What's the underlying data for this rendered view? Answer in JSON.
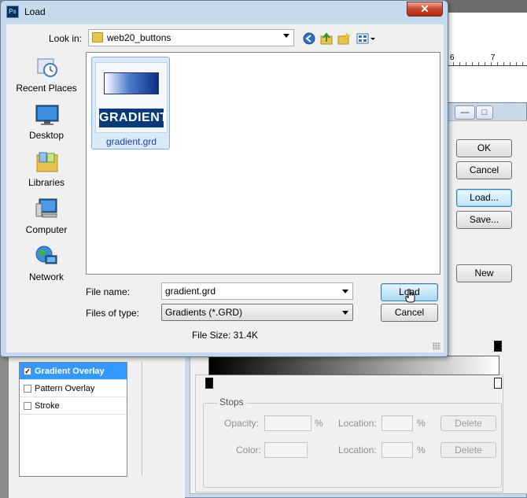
{
  "load_dialog": {
    "title": "Load",
    "close_label": "✕",
    "look_in_label": "Look in:",
    "look_in_value": "web20_buttons",
    "places": [
      {
        "label": "Recent Places",
        "icon": "recent-places-icon"
      },
      {
        "label": "Desktop",
        "icon": "desktop-icon"
      },
      {
        "label": "Libraries",
        "icon": "libraries-icon"
      },
      {
        "label": "Computer",
        "icon": "computer-icon"
      },
      {
        "label": "Network",
        "icon": "network-icon"
      }
    ],
    "files": [
      {
        "name": "gradient.grd",
        "thumbnail_text": "GRADIENT"
      }
    ],
    "file_name_label": "File name:",
    "file_name_value": "gradient.grd",
    "files_of_type_label": "Files of type:",
    "files_of_type_value": "Gradients (*.GRD)",
    "load_button": "Load",
    "cancel_button": "Cancel",
    "file_size": "File Size: 31.4K"
  },
  "gradient_editor": {
    "window_controls": [
      "—",
      "□"
    ],
    "ok_button": "OK",
    "cancel_button": "Cancel",
    "load_button": "Load...",
    "save_button": "Save...",
    "new_button": "New",
    "stops_legend": "Stops",
    "opacity_label": "Opacity:",
    "opacity_unit": "%",
    "color_label": "Color:",
    "location_label": "Location:",
    "location_unit": "%",
    "delete_button": "Delete",
    "ruler_ticks": [
      "6",
      "7"
    ]
  },
  "layer_style": {
    "items": [
      {
        "label": "Gradient Overlay",
        "checked": true,
        "selected": true
      },
      {
        "label": "Pattern Overlay",
        "checked": false,
        "selected": false
      },
      {
        "label": "Stroke",
        "checked": false,
        "selected": false
      }
    ]
  }
}
